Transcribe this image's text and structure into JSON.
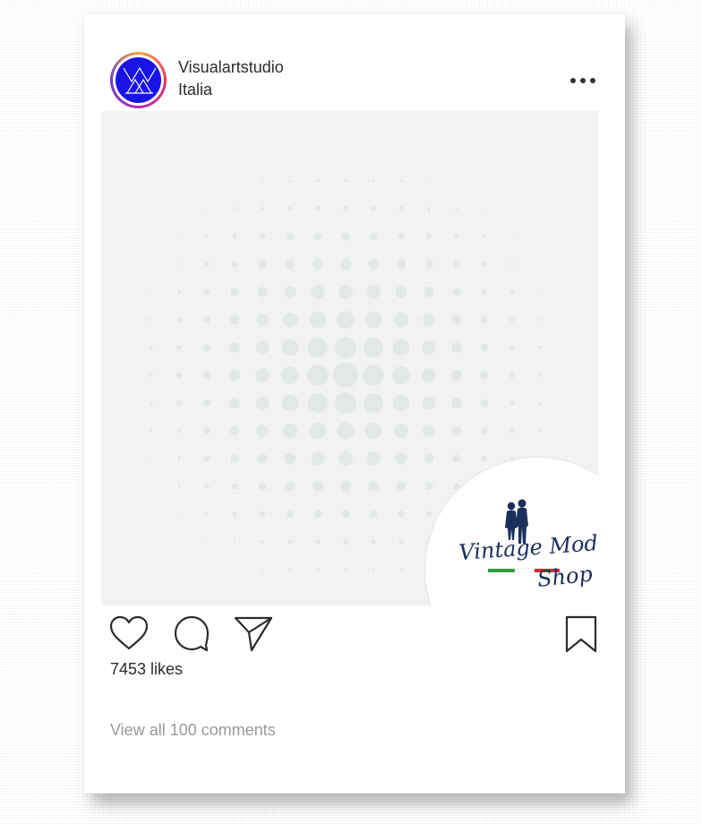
{
  "post": {
    "username": "Visualartstudio",
    "location": "Italia",
    "avatar_icon": "visualartstudio-logo-icon",
    "more_icon": "more-options-icon",
    "likes_text": "7453 likes",
    "comments_link": "View all 100 comments"
  },
  "media": {
    "pattern": "halftone-dots",
    "brand_logo": {
      "line1": "Vintage Moda",
      "line2": "Shop"
    }
  },
  "actions": {
    "like_icon": "heart-icon",
    "comment_icon": "comment-bubble-icon",
    "share_icon": "paper-plane-icon",
    "save_icon": "bookmark-icon"
  },
  "colors": {
    "avatar_blue": "#1a13e6",
    "text": "#2c2c2c",
    "muted_text": "#9a9a9a",
    "logo_navy": "#1c2e5c",
    "flag_green": "#2e9e3c",
    "flag_red": "#d42b2b"
  }
}
